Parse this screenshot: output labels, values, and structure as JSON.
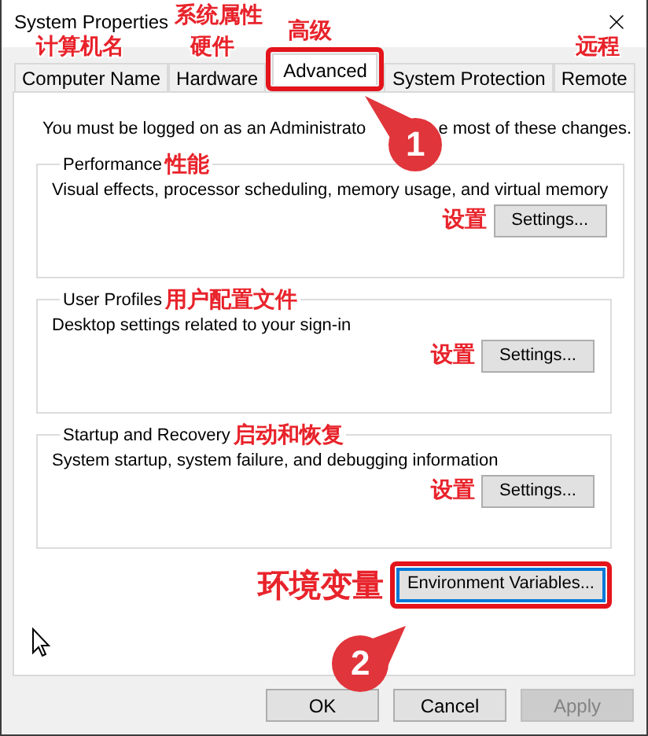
{
  "window": {
    "title": "System Properties",
    "title_annotation": "系统属性"
  },
  "tabs": [
    {
      "label": "Computer Name",
      "selected": false,
      "annotation": "计算机名",
      "highlighted": false
    },
    {
      "label": "Hardware",
      "selected": false,
      "annotation": "硬件",
      "highlighted": false
    },
    {
      "label": "Advanced",
      "selected": true,
      "annotation": "高级",
      "highlighted": true,
      "callout": "1"
    },
    {
      "label": "System Protection",
      "selected": false,
      "highlighted": false
    },
    {
      "label": "Remote",
      "selected": false,
      "annotation": "远程",
      "highlighted": false
    }
  ],
  "notice": {
    "parts": [
      "You must be logged on as an Administrato",
      "e most of these changes."
    ]
  },
  "groups": [
    {
      "title": "Performance",
      "annotation": "性能",
      "description": "Visual effects, processor scheduling, memory usage, and virtual memory",
      "button": {
        "label": "Settings...",
        "annotation": "设置"
      }
    },
    {
      "title": "User Profiles",
      "annotation": "用户配置文件",
      "description": "Desktop settings related to your sign-in",
      "button": {
        "label": "Settings...",
        "annotation": "设置"
      }
    },
    {
      "title": "Startup and Recovery",
      "annotation": "启动和恢复",
      "description": "System startup, system failure, and debugging information",
      "button": {
        "label": "Settings...",
        "annotation": "设置"
      }
    }
  ],
  "env_button": {
    "label": "Environment Variables...",
    "annotation": "环境变量",
    "highlighted": true,
    "callout": "2"
  },
  "footer_buttons": [
    {
      "label": "OK",
      "disabled": false
    },
    {
      "label": "Cancel",
      "disabled": false
    },
    {
      "label": "Apply",
      "disabled": true
    }
  ]
}
